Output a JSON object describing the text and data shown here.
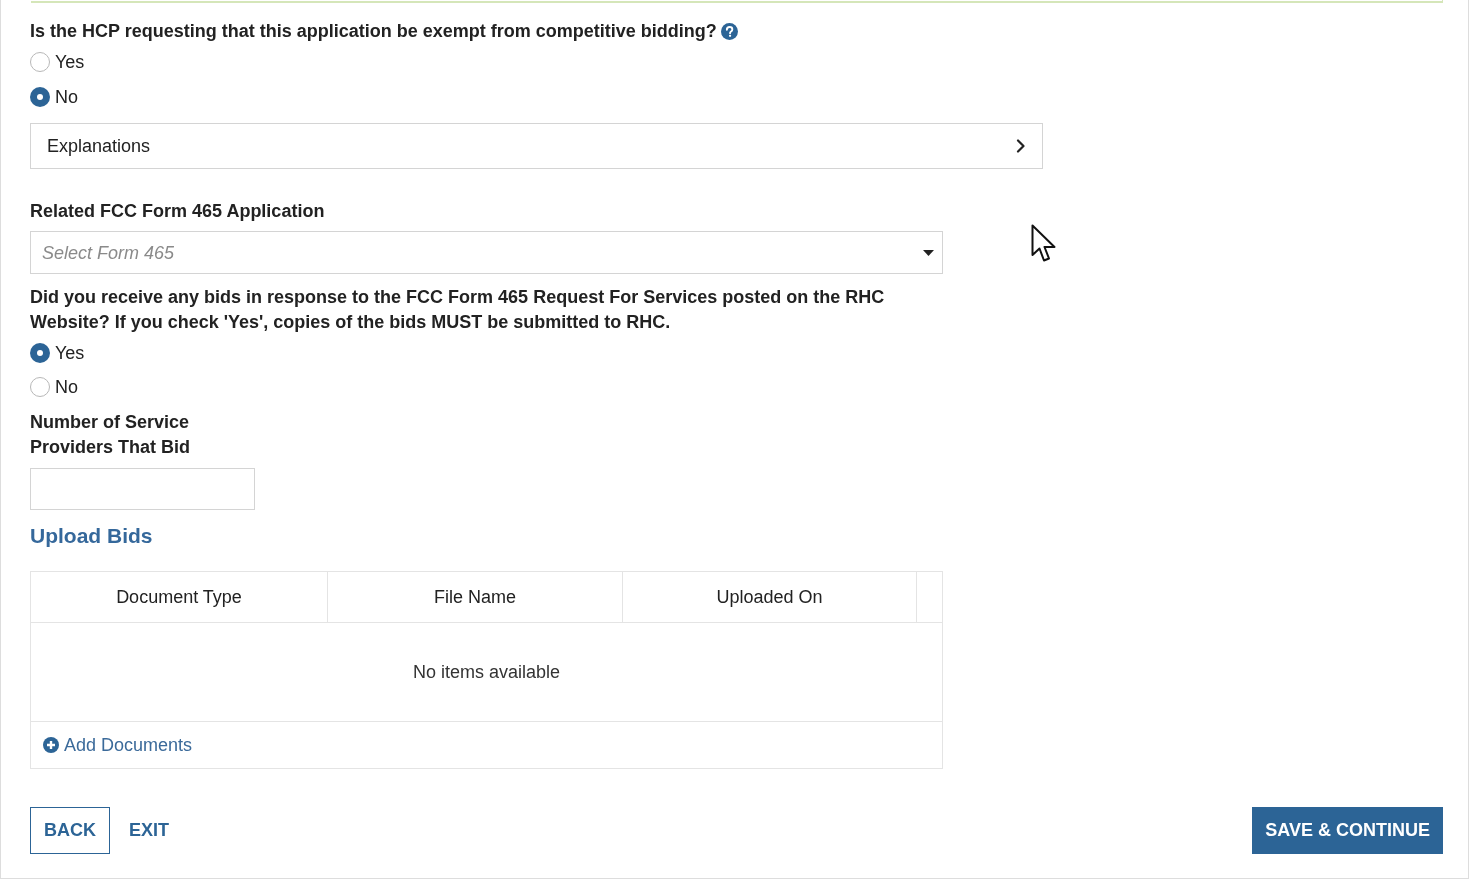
{
  "exemption_question": {
    "text": "Is the HCP requesting that this application be exempt from competitive bidding?",
    "options": [
      {
        "label": "Yes",
        "selected": false
      },
      {
        "label": "No",
        "selected": true
      }
    ]
  },
  "explanations": {
    "label": "Explanations",
    "expanded": false
  },
  "related_form_465": {
    "label": "Related FCC Form 465 Application",
    "placeholder": "Select Form 465"
  },
  "bids_question": {
    "text": "Did you receive any bids in response to the FCC Form 465 Request For Services posted on the RHC Website? If you check 'Yes', copies of the bids MUST be submitted to RHC.",
    "options": [
      {
        "label": "Yes",
        "selected": true
      },
      {
        "label": "No",
        "selected": false
      }
    ]
  },
  "provider_count": {
    "label": "Number of Service Providers That Bid"
  },
  "upload_bids": {
    "title": "Upload Bids",
    "table": {
      "columns": [
        "Document Type",
        "File Name",
        "Uploaded On"
      ],
      "empty_message": "No items available"
    },
    "add_link": "Add Documents"
  },
  "buttons": [
    {
      "label": "BACK",
      "kind": "outline"
    },
    {
      "label": "EXIT",
      "kind": "link"
    },
    {
      "label": "SAVE & CONTINUE",
      "kind": "primary"
    }
  ]
}
